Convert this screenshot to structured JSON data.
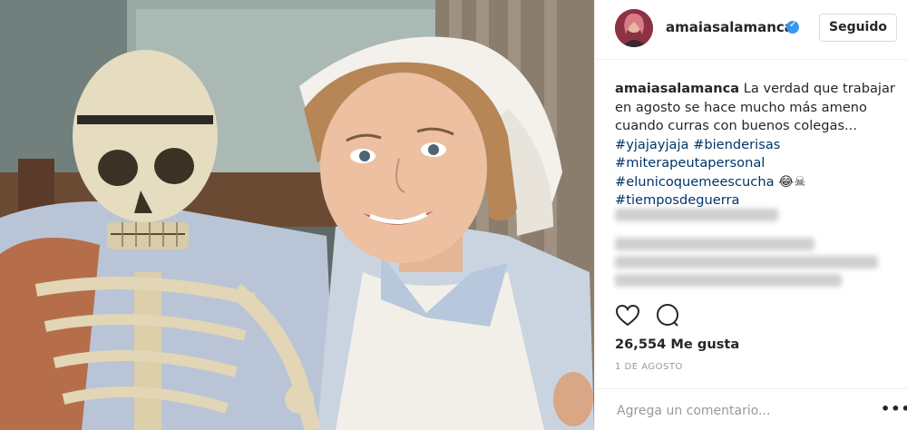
{
  "post": {
    "image_alt": "Foto publicada por amaiasalamanca"
  },
  "header": {
    "username": "amaiasalamanca",
    "follow_label": "Seguido",
    "verified_icon": "verified-badge-icon"
  },
  "caption": {
    "username": "amaiasalamanca",
    "text": "La verdad que trabajar en agosto se hace mucho más ameno cuando curras con buenos colegas...",
    "tags": [
      "#yjajayjaja",
      "#bienderisas",
      "#miterapeutapersonal",
      "#elunicoquemeescucha",
      "#tiemposdeguerra"
    ],
    "emoji": "😂☠"
  },
  "actions": {
    "like_icon": "heart-icon",
    "comment_icon": "comment-icon"
  },
  "likes": "26,554 Me gusta",
  "date": "1 DE AGOSTO",
  "comment": {
    "placeholder": "Agrega un comentario...",
    "more_label": "•••"
  },
  "colors": {
    "link": "#003569",
    "verified": "#3897f0",
    "text": "#262626",
    "muted": "#999999"
  }
}
